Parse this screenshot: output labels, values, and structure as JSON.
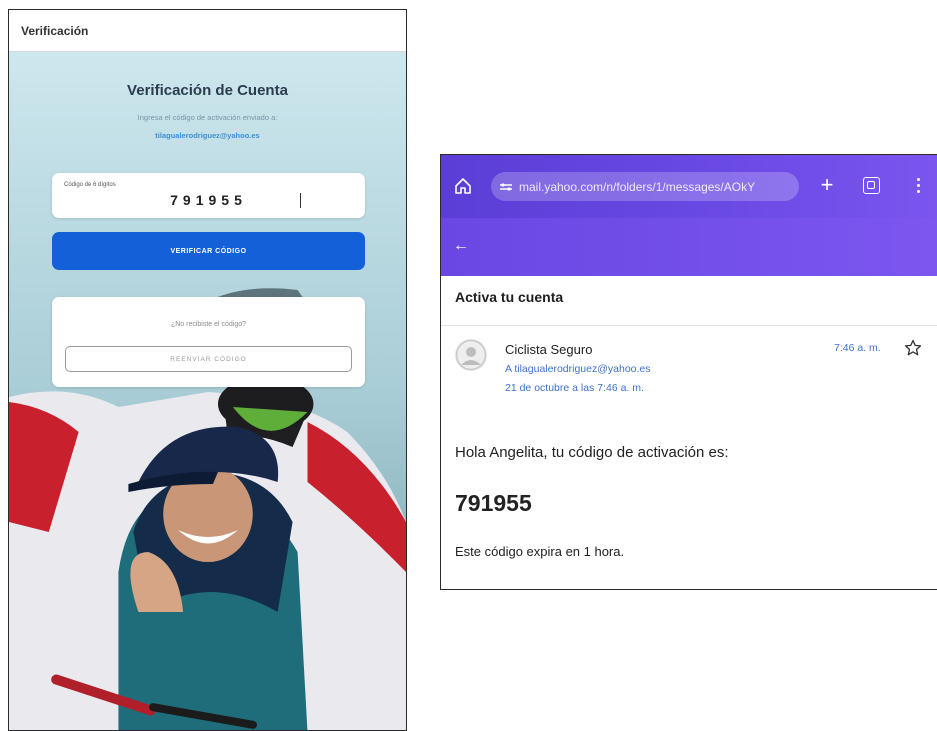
{
  "app": {
    "topbar_title": "Verificación",
    "title": "Verificación de Cuenta",
    "subtitle": "Ingresa el código de activación enviado a:",
    "email": "tilagualerodriguez@yahoo.es",
    "code_label": "Código de 6 dígitos",
    "code_value": "791955",
    "verify_button": "VERIFICAR CÓDIGO",
    "resend_question": "¿No recibiste el código?",
    "resend_button": "REENVIAR CÓDIGO"
  },
  "browser": {
    "url": "mail.yahoo.com/n/folders/1/messages/AOkY",
    "icons": [
      "home-icon",
      "site-settings-icon",
      "plus-icon",
      "tabs-icon",
      "more-vert-icon",
      "back-arrow-icon"
    ]
  },
  "email": {
    "subject": "Activa tu cuenta",
    "sender": "Ciclista Seguro",
    "to": "A tilagualerodriguez@yahoo.es",
    "date": "21 de octubre a las 7:46 a. m.",
    "time": "7:46 a. m.",
    "greeting": "Hola Angelita, tu código de activación es:",
    "code": "791955",
    "expiry": "Este código expira en 1 hora."
  },
  "colors": {
    "primary_button": "#1460d8",
    "browser_purple": "#6a47e3",
    "link_blue": "#3e72c9"
  }
}
